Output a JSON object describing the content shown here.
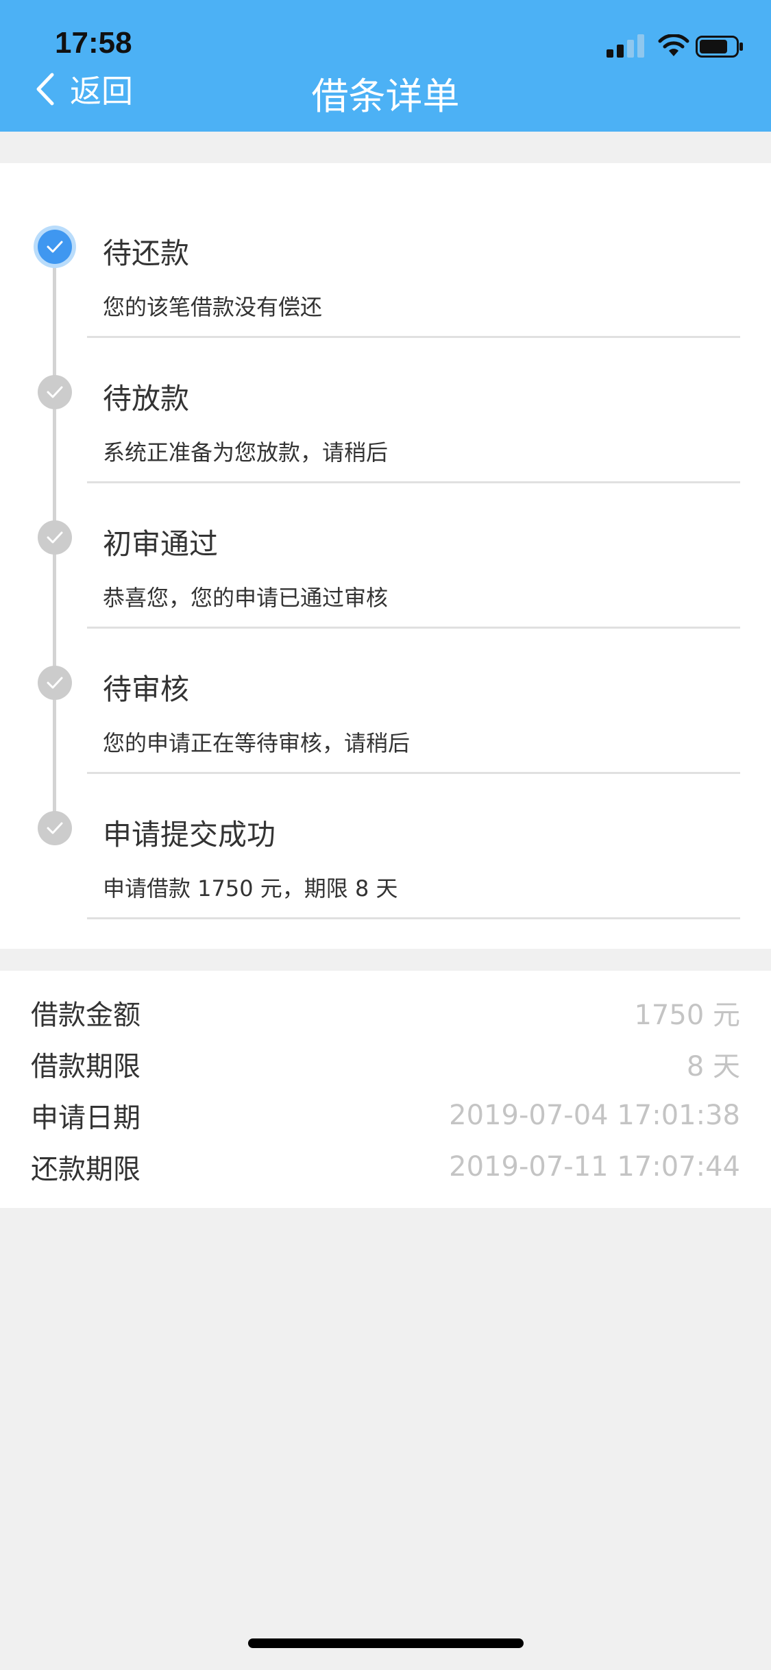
{
  "status_bar": {
    "time": "17:58",
    "icons": [
      "signal-icon",
      "wifi-icon",
      "battery-icon"
    ]
  },
  "nav": {
    "back_label": "返回",
    "title": "借条详单"
  },
  "colors": {
    "header": "#4cb1f5",
    "active": "#3f97f0",
    "inactive": "#cccccc",
    "value_text": "#c4c4c4"
  },
  "steps": [
    {
      "title": "待还款",
      "desc": "您的该笔借款没有偿还",
      "active": true
    },
    {
      "title": "待放款",
      "desc": "系统正准备为您放款，请稍后",
      "active": false
    },
    {
      "title": "初审通过",
      "desc": "恭喜您，您的申请已通过审核",
      "active": false
    },
    {
      "title": "待审核",
      "desc": "您的申请正在等待审核，请稍后",
      "active": false
    },
    {
      "title": "申请提交成功",
      "desc": "申请借款 1750 元，期限 8 天",
      "active": false
    }
  ],
  "info": [
    {
      "label": "借款金额",
      "value": "1750 元"
    },
    {
      "label": "借款期限",
      "value": "8 天"
    },
    {
      "label": "申请日期",
      "value": "2019-07-04 17:01:38"
    },
    {
      "label": "还款期限",
      "value": "2019-07-11 17:07:44"
    }
  ]
}
